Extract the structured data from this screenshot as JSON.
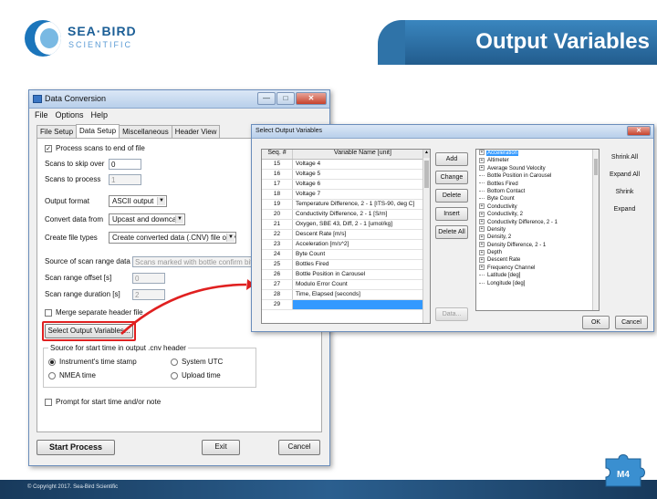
{
  "slide": {
    "logo_name": "SEA·BIRD",
    "logo_sub": "SCIENTIFIC",
    "title": "Output Variables",
    "copyright": "© Copyright 2017. Sea-Bird Scientific",
    "badge": "M4",
    "accent_color": "#2f73a8",
    "arrow_color": "#e02020"
  },
  "data_conversion": {
    "title": "Data Conversion",
    "menu": [
      "File",
      "Options",
      "Help"
    ],
    "tabs": [
      "File Setup",
      "Data Setup",
      "Miscellaneous",
      "Header View"
    ],
    "active_tab": "Data Setup",
    "process_scans_label": "Process scans to end of file",
    "process_scans_checked": true,
    "scans_to_skip_label": "Scans to skip over",
    "scans_to_skip_value": "0",
    "scans_to_process_label": "Scans to process",
    "scans_to_process_value": "1",
    "output_format_label": "Output format",
    "output_format_value": "ASCII output",
    "convert_from_label": "Convert data from",
    "convert_from_value": "Upcast and downcast",
    "create_file_types_label": "Create file types",
    "create_file_types_value": "Create converted data (.CNV) file only",
    "scan_range_source_label": "Source of scan range data",
    "scan_range_source_value": "Scans marked with bottle confirm bit",
    "scan_range_offset_label": "Scan range offset [s]",
    "scan_range_offset_value": "0",
    "scan_range_duration_label": "Scan range duration [s]",
    "scan_range_duration_value": "2",
    "merge_header_label": "Merge separate header file",
    "select_output_button": "Select Output Variables...",
    "start_time_group": "Source for start time in output .cnv header",
    "radio_instrument": "Instrument's time stamp",
    "radio_nmea": "NMEA time",
    "radio_system_utc": "System UTC",
    "radio_upload": "Upload time",
    "prompt_label": "Prompt for start time and/or note",
    "start_button": "Start Process",
    "exit_button": "Exit",
    "cancel_button": "Cancel"
  },
  "select_output": {
    "title": "Select Output Variables",
    "col_seq": "Seq. #",
    "col_name": "Variable Name [unit]",
    "rows": [
      {
        "seq": "15",
        "name": "Voltage 4"
      },
      {
        "seq": "16",
        "name": "Voltage 5"
      },
      {
        "seq": "17",
        "name": "Voltage 6"
      },
      {
        "seq": "18",
        "name": "Voltage 7"
      },
      {
        "seq": "19",
        "name": "Temperature Difference, 2 - 1 [ITS-90, deg C]"
      },
      {
        "seq": "20",
        "name": "Conductivity Difference, 2 - 1 [S/m]"
      },
      {
        "seq": "21",
        "name": "Oxygen, SBE 43, Diff, 2 - 1 [umol/kg]"
      },
      {
        "seq": "22",
        "name": "Descent Rate [m/s]"
      },
      {
        "seq": "23",
        "name": "Acceleration [m/s^2]"
      },
      {
        "seq": "24",
        "name": "Byte Count"
      },
      {
        "seq": "25",
        "name": "Bottles Fired"
      },
      {
        "seq": "26",
        "name": "Bottle Position in Carousel"
      },
      {
        "seq": "27",
        "name": "Modulo Error Count"
      },
      {
        "seq": "28",
        "name": "Time, Elapsed [seconds]"
      },
      {
        "seq": "29",
        "name": ""
      }
    ],
    "buttons": {
      "add": "Add",
      "change": "Change",
      "delete": "Delete",
      "insert": "Insert",
      "delete_all": "Delete All",
      "data": "Data..."
    },
    "tree": [
      {
        "label": "Acceleration",
        "kind": "exp",
        "hi": true
      },
      {
        "label": "Altimeter",
        "kind": "exp"
      },
      {
        "label": "Average Sound Velocity",
        "kind": "exp"
      },
      {
        "label": "Bottle Position in Carousel",
        "kind": "leaf"
      },
      {
        "label": "Bottles Fired",
        "kind": "leaf"
      },
      {
        "label": "Bottom Contact",
        "kind": "leaf"
      },
      {
        "label": "Byte Count",
        "kind": "leaf"
      },
      {
        "label": "Conductivity",
        "kind": "exp"
      },
      {
        "label": "Conductivity, 2",
        "kind": "exp"
      },
      {
        "label": "Conductivity Difference, 2 - 1",
        "kind": "exp"
      },
      {
        "label": "Density",
        "kind": "exp"
      },
      {
        "label": "Density, 2",
        "kind": "exp"
      },
      {
        "label": "Density Difference, 2 - 1",
        "kind": "exp"
      },
      {
        "label": "Depth",
        "kind": "exp"
      },
      {
        "label": "Descent Rate",
        "kind": "exp"
      },
      {
        "label": "Frequency Channel",
        "kind": "exp"
      },
      {
        "label": "Latitude [deg]",
        "kind": "leaf"
      },
      {
        "label": "Longitude [deg]",
        "kind": "leaf"
      }
    ],
    "right_buttons": {
      "shrink_all": "Shrink All",
      "expand_all": "Expand All",
      "shrink": "Shrink",
      "expand": "Expand"
    },
    "ok": "OK",
    "cancel": "Cancel"
  }
}
